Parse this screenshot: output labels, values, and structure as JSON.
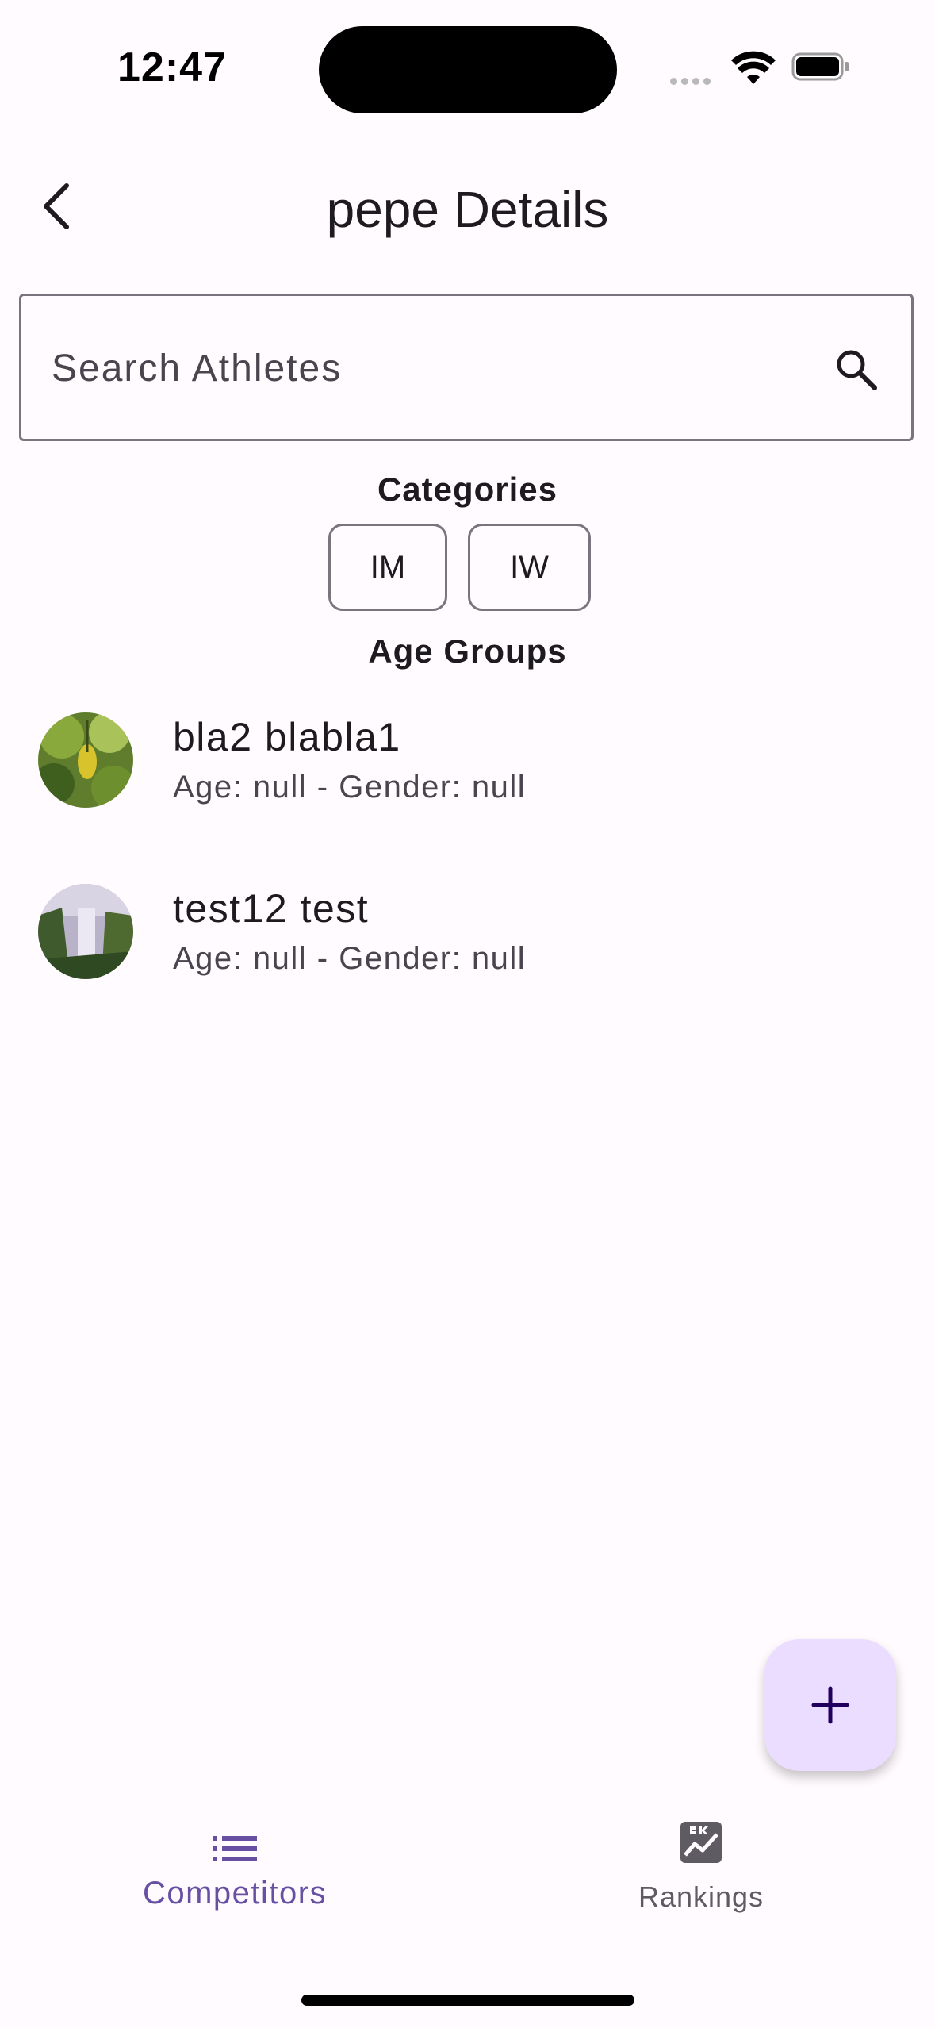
{
  "status_bar": {
    "time": "12:47"
  },
  "header": {
    "title": "pepe Details"
  },
  "search": {
    "placeholder": "Search Athletes",
    "value": ""
  },
  "categories": {
    "label": "Categories",
    "chips": [
      "IM",
      "IW"
    ]
  },
  "age_groups": {
    "label": "Age Groups"
  },
  "athletes": [
    {
      "name": "bla2 blabla1",
      "details": "Age: null - Gender: null"
    },
    {
      "name": "test12 test",
      "details": "Age: null - Gender: null"
    }
  ],
  "bottom_nav": {
    "items": [
      {
        "label": "Competitors",
        "icon": "list-icon",
        "active": true
      },
      {
        "label": "Rankings",
        "icon": "rankings-icon",
        "active": false
      }
    ]
  },
  "colors": {
    "primary": "#6750a4",
    "fab_bg": "#eaddff",
    "background": "#fffbfe",
    "outline": "#79747e"
  }
}
